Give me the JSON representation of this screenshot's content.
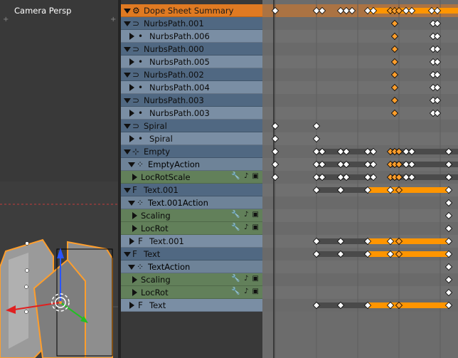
{
  "viewport": {
    "camera_label": "Camera Persp"
  },
  "colors": {
    "summary": "#e07a22",
    "object": "#506882",
    "data": "#7a8ea4",
    "fcurve": "#62805a",
    "keyframe": "#ffffff",
    "selected_key": "#ff9e2c",
    "hold_bar": "#4a4a4a",
    "hold_bar_selected": "#ff9500"
  },
  "channels": [
    {
      "label": "Dope Sheet Summary",
      "kind": "summary",
      "icon": "dopesheet-icon"
    },
    {
      "label": "NurbsPath.001",
      "kind": "object",
      "icon": "curve-icon"
    },
    {
      "label": "NurbsPath.006",
      "kind": "data",
      "icon": "curve-data-icon"
    },
    {
      "label": "NurbsPath.000",
      "kind": "object",
      "icon": "curve-icon"
    },
    {
      "label": "NurbsPath.005",
      "kind": "data",
      "icon": "curve-data-icon"
    },
    {
      "label": "NurbsPath.002",
      "kind": "object",
      "icon": "curve-icon"
    },
    {
      "label": "NurbsPath.004",
      "kind": "data",
      "icon": "curve-data-icon"
    },
    {
      "label": "NurbsPath.003",
      "kind": "object",
      "icon": "curve-icon"
    },
    {
      "label": "NurbsPath.003",
      "kind": "data",
      "icon": "curve-data-icon"
    },
    {
      "label": "Spiral",
      "kind": "object",
      "icon": "curve-icon"
    },
    {
      "label": "Spiral",
      "kind": "data",
      "icon": "curve-data-icon"
    },
    {
      "label": "Empty",
      "kind": "object",
      "icon": "empty-icon"
    },
    {
      "label": "EmptyAction",
      "kind": "action",
      "icon": "action-icon"
    },
    {
      "label": "LocRotScale",
      "kind": "fcurve",
      "icon": "fcurve-icon"
    },
    {
      "label": "Text.001",
      "kind": "object",
      "icon": "text-icon"
    },
    {
      "label": "Text.001Action",
      "kind": "action",
      "icon": "action-icon"
    },
    {
      "label": "Scaling",
      "kind": "fcurve",
      "icon": "fcurve-icon"
    },
    {
      "label": "LocRot",
      "kind": "fcurve",
      "icon": "fcurve-icon"
    },
    {
      "label": "Text.001",
      "kind": "data",
      "icon": "text-data-icon"
    },
    {
      "label": "Text",
      "kind": "object",
      "icon": "text-icon"
    },
    {
      "label": "TextAction",
      "kind": "action",
      "icon": "action-icon"
    },
    {
      "label": "Scaling",
      "kind": "fcurve",
      "icon": "fcurve-icon"
    },
    {
      "label": "LocRot",
      "kind": "fcurve",
      "icon": "fcurve-icon"
    },
    {
      "label": "Text",
      "kind": "data",
      "icon": "text-data-icon"
    }
  ],
  "channel_row_icons": [
    "wrench-icon",
    "speaker-icon",
    "lock-icon"
  ]
}
